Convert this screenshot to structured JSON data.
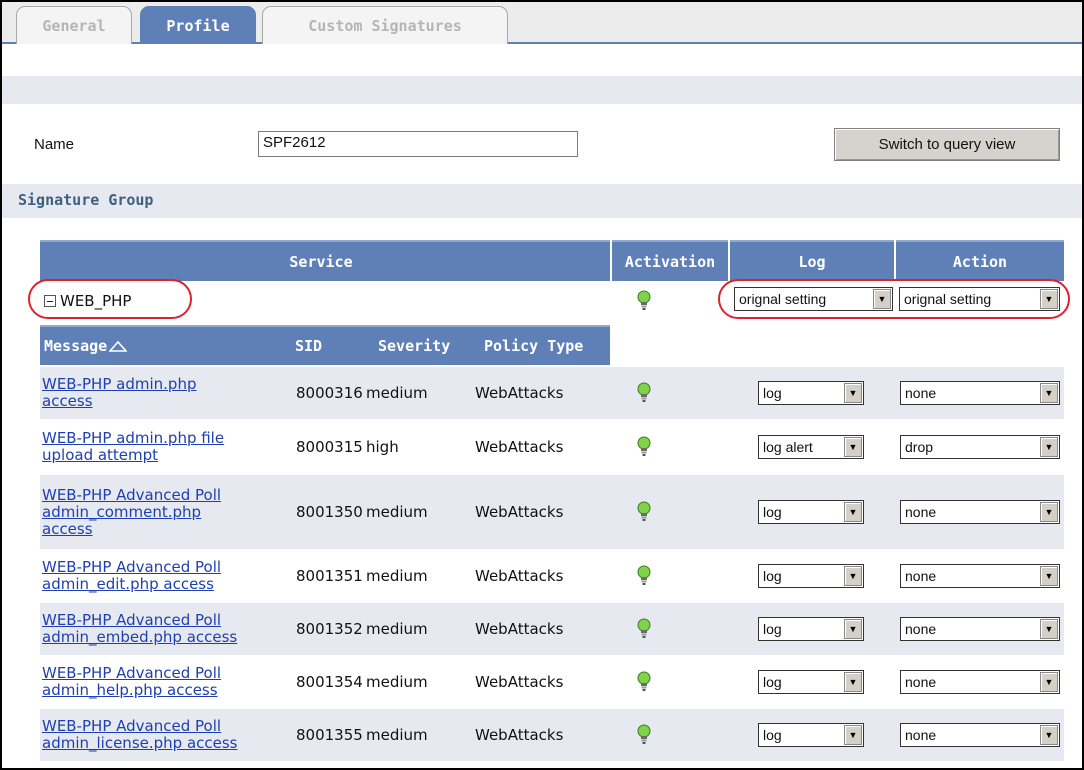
{
  "tabs": [
    {
      "label": "General",
      "active": false
    },
    {
      "label": "Profile",
      "active": true
    },
    {
      "label": "Custom Signatures",
      "active": false
    }
  ],
  "form": {
    "name_label": "Name",
    "name_value": "SPF2612",
    "switch_button": "Switch to query view"
  },
  "section": {
    "title": "Signature Group"
  },
  "table": {
    "headers": {
      "service": "Service",
      "activation": "Activation",
      "log": "Log",
      "action": "Action"
    },
    "group": {
      "name": "WEB_PHP",
      "log": "orignal setting",
      "action": "orignal setting"
    },
    "subheaders": {
      "message": "Message",
      "sid": "SID",
      "severity": "Severity",
      "policy_type": "Policy Type"
    },
    "rows": [
      {
        "message": [
          "WEB-PHP admin.php",
          "access"
        ],
        "sid": "8000316",
        "severity": "medium",
        "policy": "WebAttacks",
        "log": "log",
        "action": "none"
      },
      {
        "message": [
          "WEB-PHP admin.php file",
          "upload attempt"
        ],
        "sid": "8000315",
        "severity": "high",
        "policy": "WebAttacks",
        "log": "log alert",
        "action": "drop"
      },
      {
        "message": [
          "WEB-PHP Advanced Poll",
          "admin_comment.php",
          "access"
        ],
        "sid": "8001350",
        "severity": "medium",
        "policy": "WebAttacks",
        "log": "log",
        "action": "none"
      },
      {
        "message": [
          "WEB-PHP Advanced Poll",
          "admin_edit.php access"
        ],
        "sid": "8001351",
        "severity": "medium",
        "policy": "WebAttacks",
        "log": "log",
        "action": "none"
      },
      {
        "message": [
          "WEB-PHP Advanced Poll",
          "admin_embed.php access"
        ],
        "sid": "8001352",
        "severity": "medium",
        "policy": "WebAttacks",
        "log": "log",
        "action": "none"
      },
      {
        "message": [
          "WEB-PHP Advanced Poll",
          "admin_help.php access"
        ],
        "sid": "8001354",
        "severity": "medium",
        "policy": "WebAttacks",
        "log": "log",
        "action": "none"
      },
      {
        "message": [
          "WEB-PHP Advanced Poll",
          "admin_license.php access"
        ],
        "sid": "8001355",
        "severity": "medium",
        "policy": "WebAttacks",
        "log": "log",
        "action": "none"
      }
    ]
  },
  "colors": {
    "header_blue": "#5e80b6",
    "link": "#1f3fb0",
    "highlight_oval": "#e0202a",
    "bulb_green": "#7fd34a"
  }
}
